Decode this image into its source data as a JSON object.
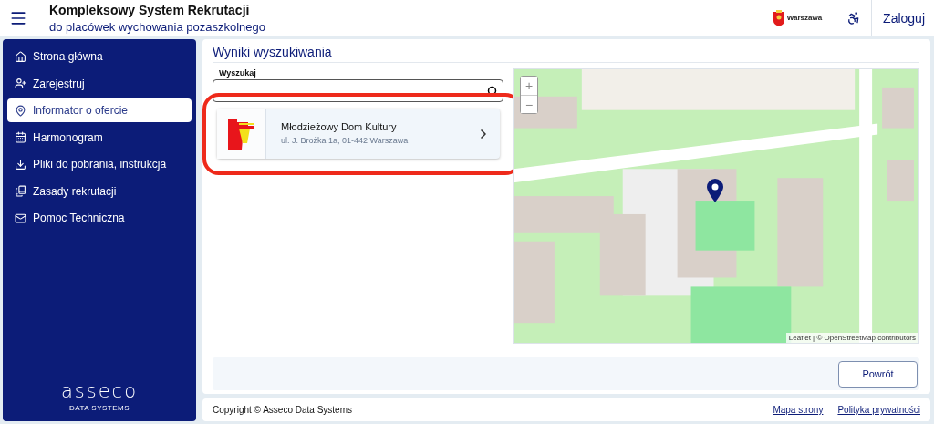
{
  "header": {
    "title": "Kompleksowy System Rekrutacji",
    "subtitle": "do placówek wychowania pozaszkolnego",
    "logo_caption": "Warszawa",
    "login": "Zaloguj"
  },
  "sidebar": {
    "items": [
      {
        "label": "Strona główna",
        "selected": false
      },
      {
        "label": "Zarejestruj",
        "selected": false
      },
      {
        "label": "Informator o ofercie",
        "selected": true
      },
      {
        "label": "Harmonogram",
        "selected": false
      },
      {
        "label": "Pliki do pobrania, instrukcja",
        "selected": false
      },
      {
        "label": "Zasady rekrutacji",
        "selected": false
      },
      {
        "label": "Pomoc Techniczna",
        "selected": false
      }
    ],
    "brand": "asseco",
    "brand_sub": "DATA SYSTEMS"
  },
  "main": {
    "title": "Wyniki wyszukiwania",
    "search": {
      "label": "Wyszukaj"
    },
    "results": [
      {
        "name": "Młodzieżowy Dom Kultury",
        "address": "ul. J. Brożka 1a, 01-442 Warszawa",
        "highlighted": true
      }
    ],
    "map": {
      "zoom_in": "+",
      "zoom_out": "−",
      "attribution": "Leaflet | © OpenStreetMap contributors"
    },
    "back_button": "Powrót"
  },
  "footer": {
    "copyright": "Copyright © Asseco Data Systems",
    "links": [
      "Mapa strony",
      "Polityka prywatności"
    ]
  }
}
